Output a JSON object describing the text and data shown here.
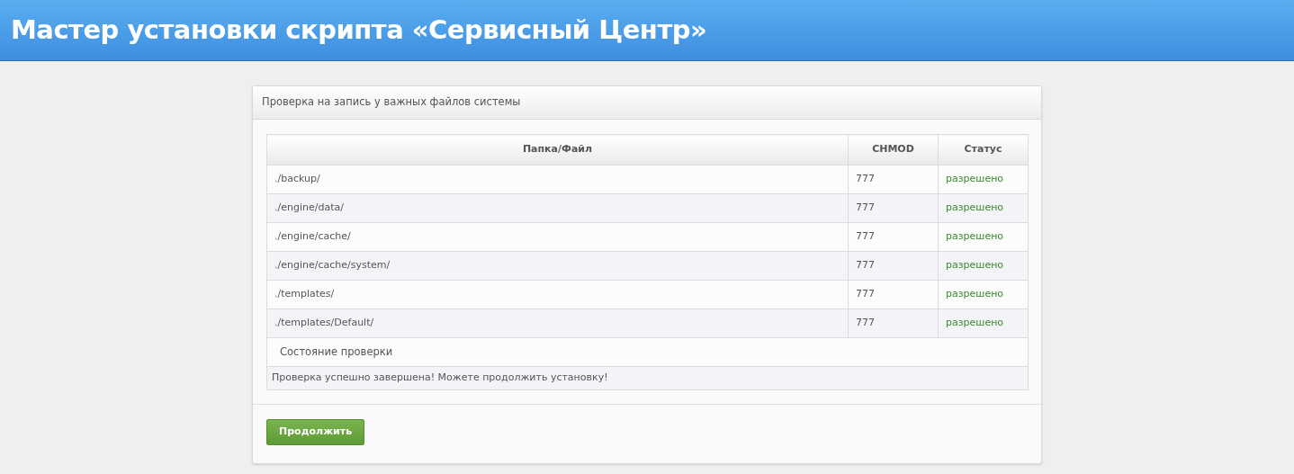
{
  "header": {
    "title": "Мастер установки скрипта «Сервисный Центр»"
  },
  "panel": {
    "title": "Проверка на запись у важных файлов системы",
    "table": {
      "columns": [
        "Папка/Файл",
        "CHMOD",
        "Статус"
      ],
      "rows": [
        {
          "path": "./backup/",
          "chmod": "777",
          "status": "разрешено",
          "ok": true
        },
        {
          "path": "./engine/data/",
          "chmod": "777",
          "status": "разрешено",
          "ok": true
        },
        {
          "path": "./engine/cache/",
          "chmod": "777",
          "status": "разрешено",
          "ok": true
        },
        {
          "path": "./engine/cache/system/",
          "chmod": "777",
          "status": "разрешено",
          "ok": true
        },
        {
          "path": "./templates/",
          "chmod": "777",
          "status": "разрешено",
          "ok": true
        },
        {
          "path": "./templates/Default/",
          "chmod": "777",
          "status": "разрешено",
          "ok": true
        }
      ],
      "result_heading": "Состояние проверки",
      "result_message": "Проверка успешно завершена! Можете продолжить установку!"
    },
    "button": "Продолжить"
  }
}
